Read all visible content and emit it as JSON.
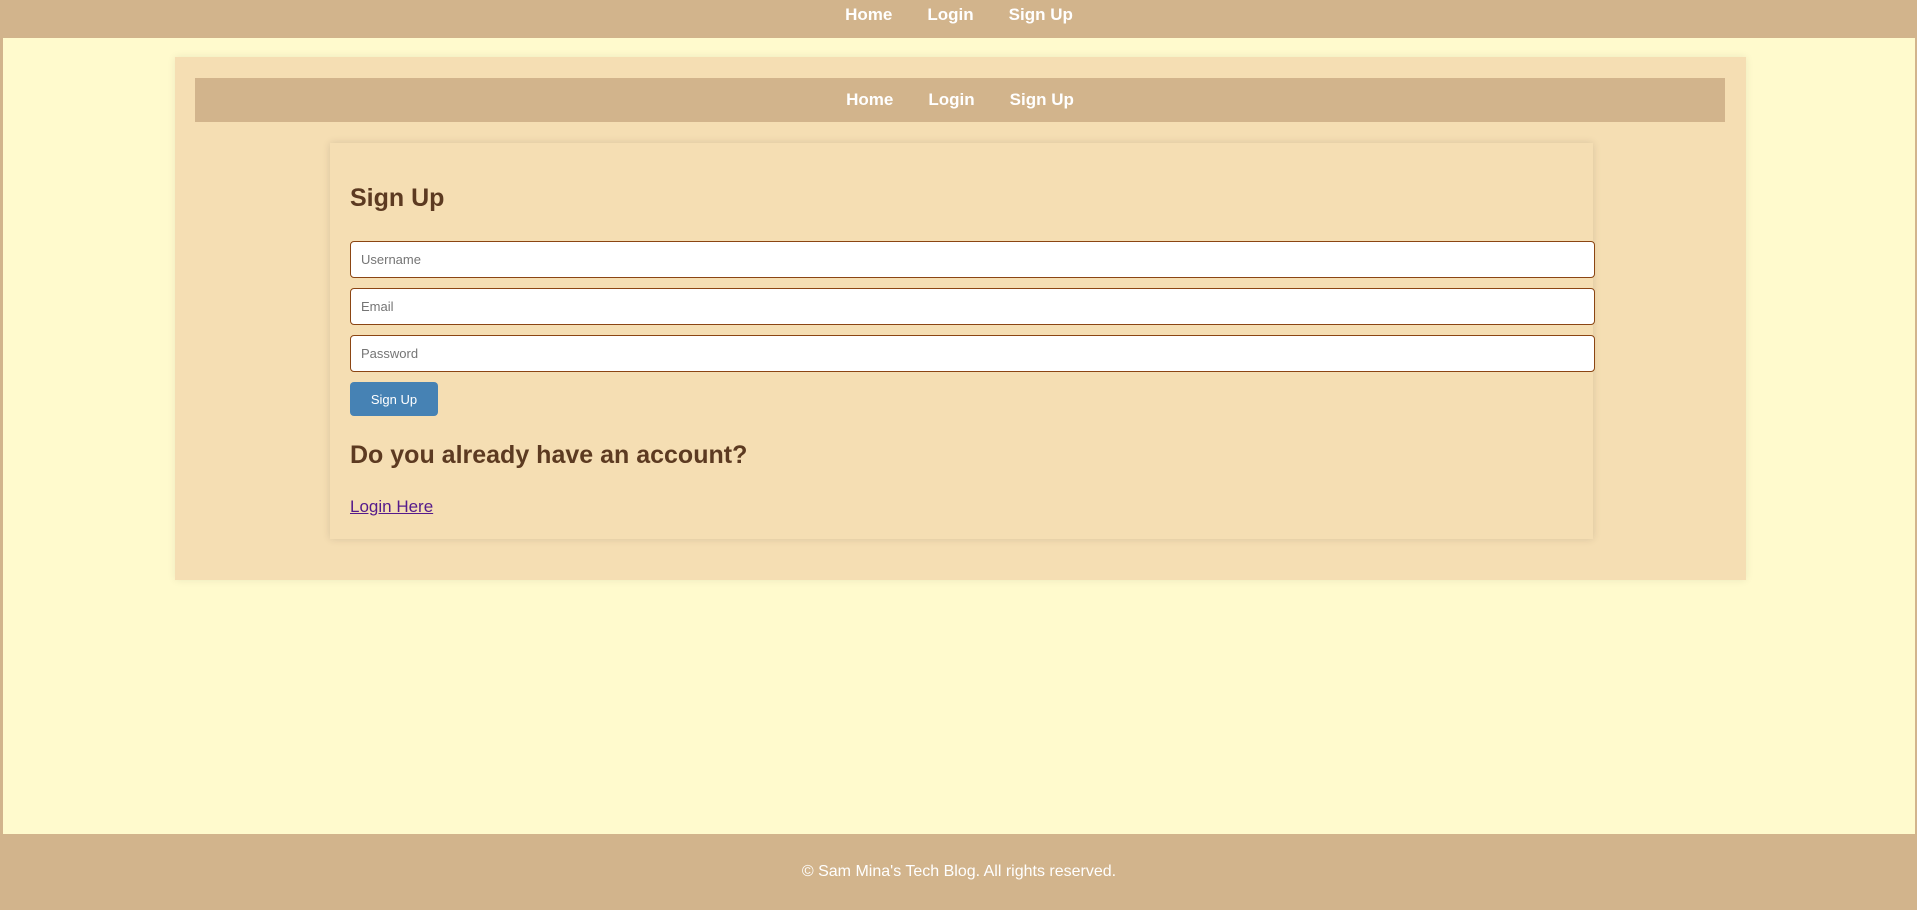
{
  "top_nav": {
    "links": [
      {
        "label": "Home"
      },
      {
        "label": "Login"
      },
      {
        "label": "Sign Up"
      }
    ]
  },
  "inner_nav": {
    "links": [
      {
        "label": "Home"
      },
      {
        "label": "Login"
      },
      {
        "label": "Sign Up"
      }
    ]
  },
  "signup": {
    "title": "Sign Up",
    "fields": {
      "username": {
        "placeholder": "Username",
        "value": ""
      },
      "email": {
        "placeholder": "Email",
        "value": ""
      },
      "password": {
        "placeholder": "Password",
        "value": ""
      }
    },
    "button_label": "Sign Up",
    "account_prompt": "Do you already have an account?",
    "login_link": "Login Here"
  },
  "footer": {
    "text": "© Sam Mina's Tech Blog. All rights reserved."
  },
  "colors": {
    "page_background": "#fffacd",
    "nav_background": "#d2b48c",
    "card_background": "#f5deb3",
    "heading_text": "#5c3a21",
    "button_background": "#4682b4",
    "input_border": "#8b4513",
    "link_color": "#551a8b"
  }
}
